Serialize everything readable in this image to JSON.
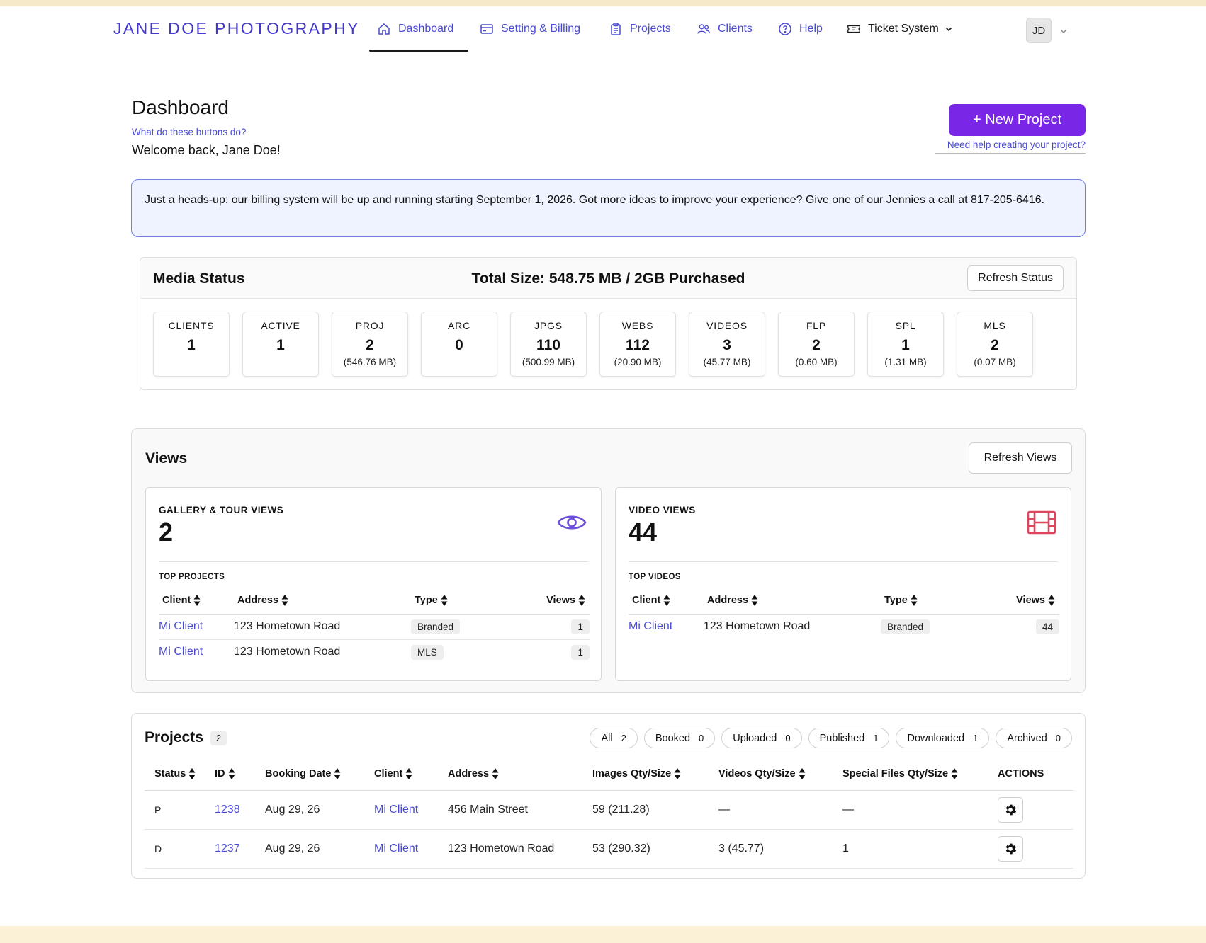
{
  "nav": {
    "brand": "JANE DOE PHOTOGRAPHY",
    "items": [
      {
        "label": "Dashboard",
        "icon": "home-icon"
      },
      {
        "label": "Setting & Billing",
        "icon": "credit-card-icon"
      },
      {
        "label": "Projects",
        "icon": "clipboard-icon"
      },
      {
        "label": "Clients",
        "icon": "users-icon"
      },
      {
        "label": "Help",
        "icon": "help-circle-icon"
      },
      {
        "label": "Ticket System",
        "icon": "ticket-icon"
      }
    ],
    "avatar": "JD",
    "accent": "#4338ca"
  },
  "header": {
    "title": "Dashboard",
    "help_link": "What do these buttons do?",
    "welcome": "Welcome back, Jane Doe!",
    "new_project": "+ New Project",
    "new_project_help": "Need help creating your project?",
    "button_color": "#7a26e6"
  },
  "notice": {
    "text": "Just a heads-up: our billing system will be up and running starting September 1, 2026. Got more ideas to improve your experience? Give one of our Jennies a call at 817-205-6416."
  },
  "media": {
    "title": "Media Status",
    "total": "Total Size: 548.75 MB / 2GB Purchased",
    "refresh": "Refresh Status",
    "stats": [
      {
        "label": "CLIENTS",
        "value": "1",
        "sub": ""
      },
      {
        "label": "ACTIVE",
        "value": "1",
        "sub": ""
      },
      {
        "label": "PROJ",
        "value": "2",
        "sub": "(546.76 MB)"
      },
      {
        "label": "ARC",
        "value": "0",
        "sub": ""
      },
      {
        "label": "JPGS",
        "value": "110",
        "sub": "(500.99 MB)"
      },
      {
        "label": "WEBS",
        "value": "112",
        "sub": "(20.90 MB)"
      },
      {
        "label": "VIDEOS",
        "value": "3",
        "sub": "(45.77 MB)"
      },
      {
        "label": "FLP",
        "value": "2",
        "sub": "(0.60 MB)"
      },
      {
        "label": "SPL",
        "value": "1",
        "sub": "(1.31 MB)"
      },
      {
        "label": "MLS",
        "value": "2",
        "sub": "(0.07 MB)"
      }
    ]
  },
  "views": {
    "title": "Views",
    "refresh": "Refresh Views",
    "gallery": {
      "label": "GALLERY & TOUR VIEWS",
      "count": "2",
      "sub": "TOP PROJECTS",
      "icon": "eye-icon",
      "icon_color": "#6d4fd8",
      "columns": [
        "Client",
        "Address",
        "Type",
        "Views"
      ],
      "rows": [
        {
          "client": "Mi Client",
          "address": "123 Hometown Road",
          "type": "Branded",
          "views": "1"
        },
        {
          "client": "Mi Client",
          "address": "123 Hometown Road",
          "type": "MLS",
          "views": "1"
        }
      ]
    },
    "video": {
      "label": "VIDEO VIEWS",
      "count": "44",
      "sub": "TOP VIDEOS",
      "icon": "film-icon",
      "icon_color": "#e0455e",
      "columns": [
        "Client",
        "Address",
        "Type",
        "Views"
      ],
      "rows": [
        {
          "client": "Mi Client",
          "address": "123 Hometown Road",
          "type": "Branded",
          "views": "44"
        }
      ]
    }
  },
  "projects": {
    "title": "Projects",
    "count": "2",
    "filters": [
      {
        "label": "All",
        "count": "2"
      },
      {
        "label": "Booked",
        "count": "0"
      },
      {
        "label": "Uploaded",
        "count": "0"
      },
      {
        "label": "Published",
        "count": "1"
      },
      {
        "label": "Downloaded",
        "count": "1"
      },
      {
        "label": "Archived",
        "count": "0"
      }
    ],
    "columns": [
      "Status",
      "ID",
      "Booking Date",
      "Client",
      "Address",
      "Images Qty/Size",
      "Videos Qty/Size",
      "Special Files Qty/Size",
      "ACTIONS"
    ],
    "rows": [
      {
        "status": "P",
        "id": "1238",
        "date": "Aug 29, 26",
        "client": "Mi Client",
        "address": "456 Main Street",
        "images": "59 (211.28)",
        "videos": "—",
        "special": "—"
      },
      {
        "status": "D",
        "id": "1237",
        "date": "Aug 29, 26",
        "client": "Mi Client",
        "address": "123 Hometown Road",
        "images": "53 (290.32)",
        "videos": "3 (45.77)",
        "special": "1"
      }
    ]
  }
}
